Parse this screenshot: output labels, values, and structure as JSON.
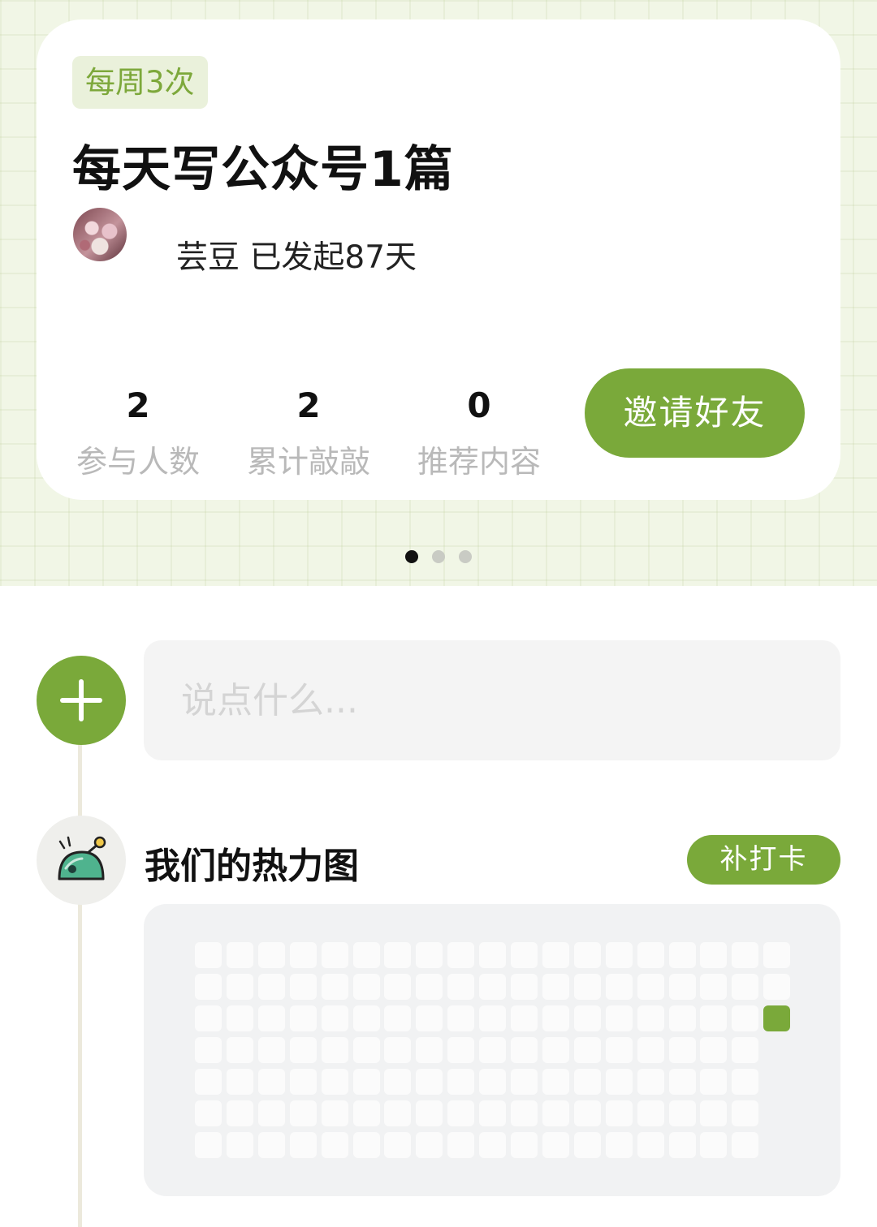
{
  "card": {
    "frequency_tag": "每周3次",
    "title": "每天写公众号1篇",
    "creator_text": "芸豆 已发起87天",
    "stats": [
      {
        "value": "2",
        "label": "参与人数"
      },
      {
        "value": "2",
        "label": "累计敲敲"
      },
      {
        "value": "0",
        "label": "推荐内容"
      }
    ],
    "invite_label": "邀请好友"
  },
  "pager": {
    "count": 3,
    "active_index": 0
  },
  "composer": {
    "placeholder": "说点什么...",
    "add_icon": "plus-icon"
  },
  "heatmap": {
    "icon": "knock-bell-icon",
    "title": "我们的热力图",
    "makeup_label": "补打卡",
    "weeks": 19,
    "days_per_week": 7,
    "current_week_days": 3,
    "checked_cells": [
      {
        "week": 18,
        "day": 2
      }
    ]
  },
  "colors": {
    "accent": "#7aa93a",
    "band_bg": "#f1f6e6",
    "tag_bg": "#eaf1db",
    "tag_text": "#7da83b",
    "stat_label": "#b9b9b9",
    "panel_bg": "#f1f2f3",
    "cell_empty": "#fbfbfb"
  }
}
